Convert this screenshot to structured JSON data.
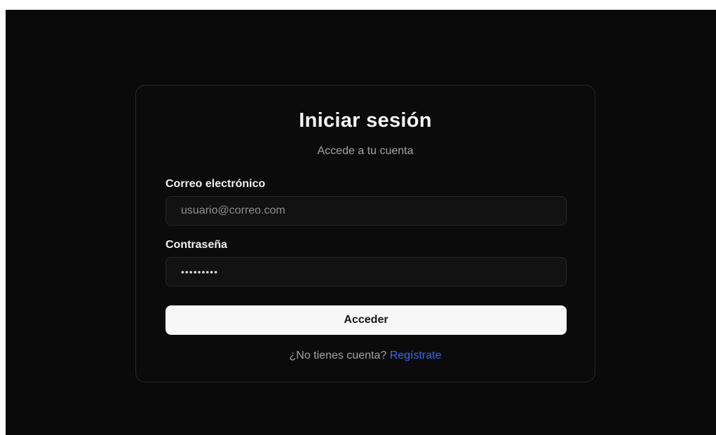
{
  "login": {
    "title": "Iniciar sesión",
    "subtitle": "Accede a tu cuenta",
    "email_label": "Correo electrónico",
    "email_placeholder": "usuario@correo.com",
    "password_label": "Contraseña",
    "password_value": "•••••••••",
    "submit_label": "Acceder",
    "footer_text": "¿No tienes cuenta? ",
    "register_link": "Regístrate"
  },
  "colors": {
    "background": "#0a0a0a",
    "card_border": "#2a2a2a",
    "button_bg": "#f7f7f7",
    "link": "#2f6bf2"
  }
}
